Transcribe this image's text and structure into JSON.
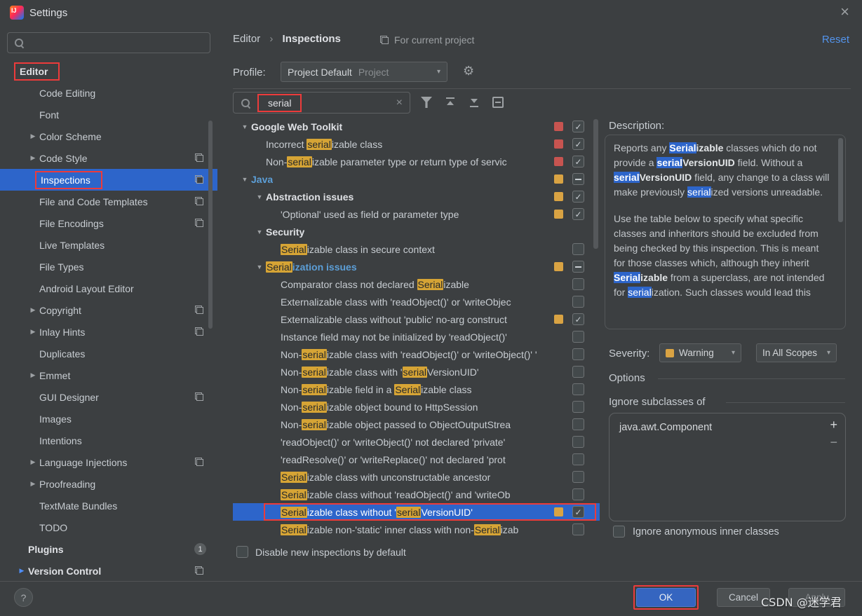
{
  "window": {
    "title": "Settings",
    "close": "×"
  },
  "watermark": "CSDN @迷学君",
  "colors": {
    "selection_blue": "#2d65ca",
    "search_match_highlight": "#d6a435",
    "error_red_square": "#c75450",
    "warning_yellow_square": "#d9a343",
    "annotation_red": "#ec3b3b",
    "link_blue": "#5394ec",
    "ok_button_blue": "#3565c0"
  },
  "sidebar": {
    "items": [
      {
        "id": "editor",
        "label": "Editor",
        "pl": 26,
        "slot": false,
        "bold": true,
        "ann": true
      },
      {
        "id": "code-editing",
        "label": "Code Editing",
        "pl": 38,
        "slot": true
      },
      {
        "id": "font",
        "label": "Font",
        "pl": 38,
        "slot": true
      },
      {
        "id": "color-scheme",
        "label": "Color Scheme",
        "pl": 38,
        "slot": true,
        "arrow": true
      },
      {
        "id": "code-style",
        "label": "Code Style",
        "pl": 38,
        "slot": true,
        "arrow": true,
        "pp": true
      },
      {
        "id": "inspections",
        "label": "Inspections",
        "pl": 38,
        "slot": true,
        "selected": true,
        "ann": true,
        "pp": true
      },
      {
        "id": "file-and-code-templates",
        "label": "File and Code Templates",
        "pl": 38,
        "slot": true,
        "pp": true
      },
      {
        "id": "file-encodings",
        "label": "File Encodings",
        "pl": 38,
        "slot": true,
        "pp": true
      },
      {
        "id": "live-templates",
        "label": "Live Templates",
        "pl": 38,
        "slot": true
      },
      {
        "id": "file-types",
        "label": "File Types",
        "pl": 38,
        "slot": true
      },
      {
        "id": "android-layout-editor",
        "label": "Android Layout Editor",
        "pl": 38,
        "slot": true
      },
      {
        "id": "copyright",
        "label": "Copyright",
        "pl": 38,
        "slot": true,
        "arrow": true,
        "pp": true
      },
      {
        "id": "inlay-hints",
        "label": "Inlay Hints",
        "pl": 38,
        "slot": true,
        "arrow": true,
        "pp": true
      },
      {
        "id": "duplicates",
        "label": "Duplicates",
        "pl": 38,
        "slot": true
      },
      {
        "id": "emmet",
        "label": "Emmet",
        "pl": 38,
        "slot": true,
        "arrow": true
      },
      {
        "id": "gui-designer",
        "label": "GUI Designer",
        "pl": 38,
        "slot": true,
        "pp": true
      },
      {
        "id": "images",
        "label": "Images",
        "pl": 38,
        "slot": true
      },
      {
        "id": "intentions",
        "label": "Intentions",
        "pl": 38,
        "slot": true
      },
      {
        "id": "language-injections",
        "label": "Language Injections",
        "pl": 38,
        "slot": true,
        "arrow": true,
        "pp": true
      },
      {
        "id": "proofreading",
        "label": "Proofreading",
        "pl": 38,
        "slot": true,
        "arrow": true
      },
      {
        "id": "textmate-bundles",
        "label": "TextMate Bundles",
        "pl": 38,
        "slot": true
      },
      {
        "id": "todo",
        "label": "TODO",
        "pl": 38,
        "slot": true
      },
      {
        "id": "plugins",
        "label": "Plugins",
        "pl": 40,
        "slot": false,
        "bold": true,
        "badge": "1"
      },
      {
        "id": "version-control",
        "label": "Version Control",
        "pl": 22,
        "slot": true,
        "arrow": true,
        "bold": true,
        "pp": true,
        "arrowBlue": true
      }
    ]
  },
  "header": {
    "breadcrumb": [
      "Editor",
      "Inspections"
    ],
    "for_current_project": "For current project",
    "reset": "Reset",
    "profile_label": "Profile:",
    "profile_value": "Project Default",
    "profile_hint": "Project"
  },
  "search": {
    "value": "serial"
  },
  "tree": {
    "disable_label": "Disable new inspections by default",
    "rows": [
      {
        "level": 0,
        "arrow": true,
        "bold": true,
        "label": [
          {
            "t": "Google Web Toolkit"
          }
        ],
        "sq": "red",
        "cb": "on"
      },
      {
        "level": 1,
        "label": [
          {
            "t": "Incorrect "
          },
          {
            "t": "serial",
            "s": "hl"
          },
          {
            "t": "izable class"
          }
        ],
        "sq": "red",
        "cb": "on"
      },
      {
        "level": 1,
        "label": [
          {
            "t": "Non-"
          },
          {
            "t": "serial",
            "s": "hl"
          },
          {
            "t": "izable parameter type or return type of servic"
          }
        ],
        "sq": "red",
        "cb": "on"
      },
      {
        "level": 0,
        "arrow": true,
        "bold": true,
        "blue": true,
        "label": [
          {
            "t": "Java"
          }
        ],
        "sq": "yellow",
        "cb": "dash"
      },
      {
        "level": 1,
        "arrow": true,
        "bold": true,
        "label": [
          {
            "t": "Abstraction issues"
          }
        ],
        "sq": "yellow",
        "cb": "on"
      },
      {
        "level": 2,
        "label": [
          {
            "t": "'Optional' used as field or parameter type"
          }
        ],
        "sq": "yellow",
        "cb": "on"
      },
      {
        "level": 1,
        "arrow": true,
        "bold": true,
        "label": [
          {
            "t": "Security"
          }
        ]
      },
      {
        "level": 2,
        "label": [
          {
            "t": "Serial",
            "s": "hl"
          },
          {
            "t": "izable class in secure context"
          }
        ],
        "cb": "off"
      },
      {
        "level": 1,
        "arrow": true,
        "bold": true,
        "blue": true,
        "label": [
          {
            "t": "Serial",
            "s": "hl"
          },
          {
            "t": "ization issues"
          }
        ],
        "sq": "yellow",
        "cb": "dash"
      },
      {
        "level": 2,
        "label": [
          {
            "t": "Comparator class not declared "
          },
          {
            "t": "Serial",
            "s": "hl"
          },
          {
            "t": "izable"
          }
        ],
        "cb": "off"
      },
      {
        "level": 2,
        "label": [
          {
            "t": "Externalizable class with 'readObject()' or 'writeObjec"
          }
        ],
        "cb": "off"
      },
      {
        "level": 2,
        "label": [
          {
            "t": "Externalizable class without 'public' no-arg construct"
          }
        ],
        "sq": "yellow",
        "cb": "on"
      },
      {
        "level": 2,
        "label": [
          {
            "t": "Instance field may not be initialized by 'readObject()'"
          }
        ],
        "cb": "off"
      },
      {
        "level": 2,
        "label": [
          {
            "t": "Non-"
          },
          {
            "t": "serial",
            "s": "hl"
          },
          {
            "t": "izable class with 'readObject()' or 'writeObject()' '"
          }
        ],
        "cb": "off"
      },
      {
        "level": 2,
        "label": [
          {
            "t": "Non-"
          },
          {
            "t": "serial",
            "s": "hl"
          },
          {
            "t": "izable class with '"
          },
          {
            "t": "serial",
            "s": "hl"
          },
          {
            "t": "VersionUID'"
          }
        ],
        "cb": "off"
      },
      {
        "level": 2,
        "label": [
          {
            "t": "Non-"
          },
          {
            "t": "serial",
            "s": "hl"
          },
          {
            "t": "izable field in a "
          },
          {
            "t": "Serial",
            "s": "hl"
          },
          {
            "t": "izable class"
          }
        ],
        "cb": "off"
      },
      {
        "level": 2,
        "label": [
          {
            "t": "Non-"
          },
          {
            "t": "serial",
            "s": "hl"
          },
          {
            "t": "izable object bound to HttpSession"
          }
        ],
        "cb": "off"
      },
      {
        "level": 2,
        "label": [
          {
            "t": "Non-"
          },
          {
            "t": "serial",
            "s": "hl"
          },
          {
            "t": "izable object passed to ObjectOutputStrea"
          }
        ],
        "cb": "off"
      },
      {
        "level": 2,
        "label": [
          {
            "t": "'readObject()' or 'writeObject()' not declared 'private'"
          }
        ],
        "cb": "off"
      },
      {
        "level": 2,
        "label": [
          {
            "t": "'readResolve()' or 'writeReplace()' not declared 'prot"
          }
        ],
        "cb": "off"
      },
      {
        "level": 2,
        "label": [
          {
            "t": "Serial",
            "s": "hl"
          },
          {
            "t": "izable class with unconstructable ancestor"
          }
        ],
        "cb": "off"
      },
      {
        "level": 2,
        "label": [
          {
            "t": "Serial",
            "s": "hl"
          },
          {
            "t": "izable class without 'readObject()' and 'writeOb"
          }
        ],
        "cb": "off"
      },
      {
        "level": 2,
        "selected": true,
        "annotated": true,
        "label": [
          {
            "t": "Serial",
            "s": "hl"
          },
          {
            "t": "izable class without '"
          },
          {
            "t": "serial",
            "s": "hl"
          },
          {
            "t": "VersionUID'"
          }
        ],
        "sq": "yellow",
        "cb": "on"
      },
      {
        "level": 2,
        "label": [
          {
            "t": "Serial",
            "s": "hl"
          },
          {
            "t": "izable non-'static' inner class with non-"
          },
          {
            "t": "Serial",
            "s": "hl"
          },
          {
            "t": "izab"
          }
        ],
        "cb": "off"
      }
    ]
  },
  "details": {
    "description_label": "Description:",
    "paragraphs": [
      [
        {
          "t": "Reports any "
        },
        {
          "t": "Serial",
          "s": "bh"
        },
        {
          "t": "izable",
          "s": "b"
        },
        {
          "t": " classes which do not provide a "
        },
        {
          "t": "serial",
          "s": "bh"
        },
        {
          "t": "VersionUID",
          "s": "b"
        },
        {
          "t": " field. Without a "
        },
        {
          "t": "serial",
          "s": "bh"
        },
        {
          "t": "VersionUID",
          "s": "b"
        },
        {
          "t": " field, any change to a class will make previously "
        },
        {
          "t": "serial",
          "s": "h"
        },
        {
          "t": "ized versions unreadable."
        }
      ],
      [
        {
          "t": "Use the table below to specify what specific classes and inheritors should be excluded from being checked by this inspection. This is meant for those classes which, although they inherit "
        },
        {
          "t": "Serial",
          "s": "bh"
        },
        {
          "t": "izable",
          "s": "b"
        },
        {
          "t": " from a superclass, are not intended for "
        },
        {
          "t": "serial",
          "s": "h"
        },
        {
          "t": "ization. Such classes would lead this"
        }
      ]
    ],
    "severity_label": "Severity:",
    "severity_value": "Warning",
    "scope_value": "In All Scopes",
    "options_label": "Options",
    "ignore_subclasses_label": "Ignore subclasses of",
    "ignore_list": [
      "java.awt.Component"
    ],
    "add_label": "+",
    "remove_label": "−",
    "ignore_anon_label": "Ignore anonymous inner classes"
  },
  "footer": {
    "help": "?",
    "ok": "OK",
    "cancel": "Cancel",
    "apply": "Apply"
  }
}
